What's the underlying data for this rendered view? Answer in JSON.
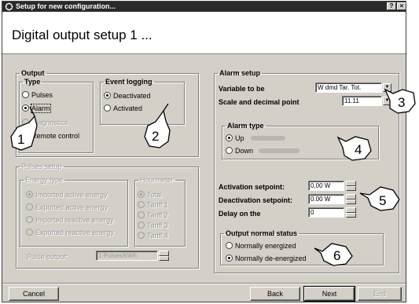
{
  "window": {
    "title": "Setup for new configuration...",
    "help_button": "?",
    "close_button": "×"
  },
  "header": {
    "heading": "Digital output setup 1 ..."
  },
  "output": {
    "group_label": "Output",
    "type": {
      "label": "Type",
      "options": [
        {
          "label": "Pulses",
          "selected": false,
          "enabled": true
        },
        {
          "label": "Alarm",
          "selected": true,
          "enabled": true
        },
        {
          "label": "Diagnostics",
          "selected": false,
          "enabled": false
        },
        {
          "label": "Remote control",
          "selected": false,
          "enabled": true
        }
      ]
    },
    "event_logging": {
      "label": "Event logging",
      "options": [
        {
          "label": "Deactivated",
          "selected": true
        },
        {
          "label": "Activated",
          "selected": false
        }
      ]
    }
  },
  "pulses_setup": {
    "label": "Pulses setup",
    "energy_type": {
      "label": "Energy type",
      "options": [
        "Imported active energy",
        "Exported active energy",
        "Imported reactive energy",
        "Exported reactive energy"
      ]
    },
    "hourmeter": {
      "label": "Hourmeter",
      "options": [
        "Total",
        "Tariff 1",
        "Tariff 2",
        "Tariff 3",
        "Tariff 4"
      ]
    },
    "pulse_output_label": "Pulse output:",
    "pulse_output_value": "1 Pulses/kWh"
  },
  "alarm_setup": {
    "label": "Alarm setup",
    "variable_label": "Variable to be",
    "variable_value": "W dmd Tar. Tot.",
    "scale_label": "Scale and decimal point",
    "scale_value": "11.11",
    "alarm_type": {
      "label": "Alarm type",
      "options": [
        {
          "label": "Up",
          "selected": true
        },
        {
          "label": "Down",
          "selected": false
        }
      ]
    },
    "activation_label": "Activation setpoint:",
    "activation_value": "0,00 W",
    "deactivation_label": "Deactivation setpoint:",
    "deactivation_value": "0.00 W",
    "delay_label": "Delay on the",
    "delay_value": "0",
    "output_normal_status": {
      "label": "Output normal status",
      "options": [
        {
          "label": "Normally energized",
          "selected": false
        },
        {
          "label": "Normally de-energized",
          "selected": true
        }
      ]
    }
  },
  "buttons": {
    "cancel": "Cancel",
    "back": "Back",
    "next": "Next",
    "end": "End"
  },
  "callouts": [
    "1",
    "2",
    "3",
    "4",
    "5",
    "6"
  ]
}
